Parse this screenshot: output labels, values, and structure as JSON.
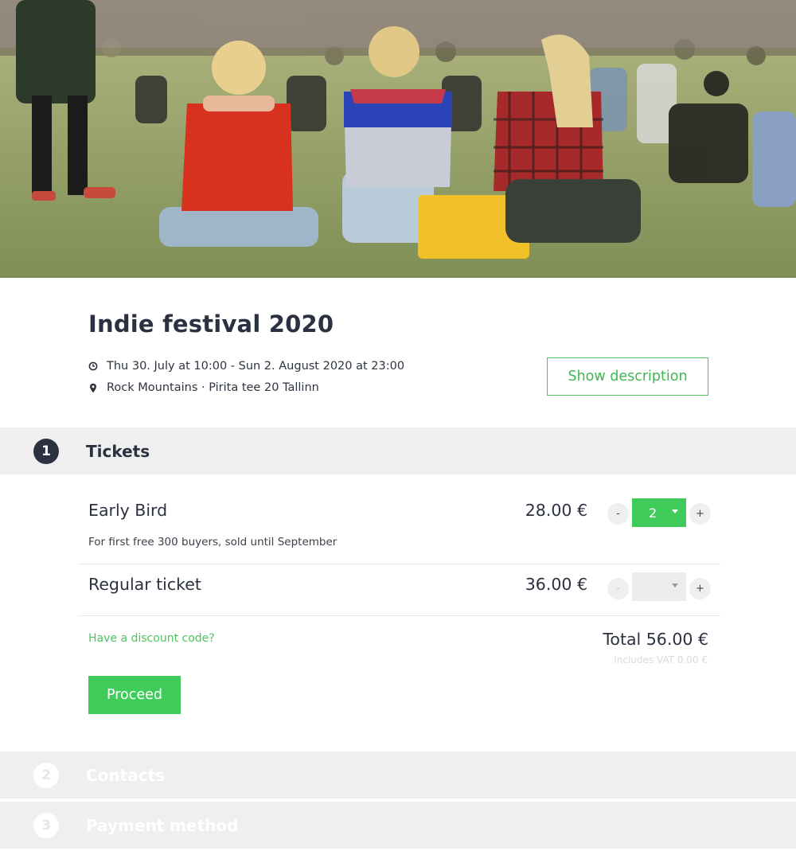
{
  "event": {
    "title": "Indie festival 2020",
    "date": "Thu 30. July at 10:00 - Sun 2. August 2020 at 23:00",
    "location": "Rock Mountains · Pirita tee 20 Tallinn",
    "date_icon": "clock-icon",
    "location_icon": "map-pin-icon",
    "show_description_label": "Show description"
  },
  "steps": [
    {
      "number": "1",
      "label": "Tickets"
    },
    {
      "number": "2",
      "label": "Contacts"
    },
    {
      "number": "3",
      "label": "Payment method"
    }
  ],
  "tickets": [
    {
      "name": "Early Bird",
      "description": "For first free 300 buyers, sold until September",
      "price": "28.00 €",
      "quantity": "2",
      "minus_label": "-",
      "plus_label": "+"
    },
    {
      "name": "Regular ticket",
      "price": "36.00 €",
      "quantity": "",
      "minus_label": "-",
      "plus_label": "+"
    }
  ],
  "summary": {
    "discount_link": "Have a discount code?",
    "total": "Total 56.00 €",
    "vat": "Includes VAT 0.00 €",
    "proceed_label": "Proceed"
  },
  "colors": {
    "accent_green": "#3fcc5a",
    "dark_text": "#2b3140",
    "step_bar": "#efefef"
  }
}
